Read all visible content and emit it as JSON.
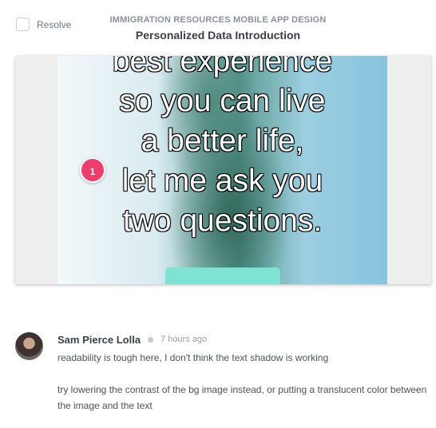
{
  "resolve": {
    "label": "Resolve"
  },
  "header": {
    "project": "IMMIGRATION RESOURCES MOBILE APP DESIGN",
    "screen_title": "Personalized Data Introduction"
  },
  "design": {
    "lines": [
      "best experience",
      "so you can live",
      "a better life,",
      "let me ask you",
      "two questions."
    ],
    "button_label": "",
    "accent_button_color": "#7ee3d2"
  },
  "pin": {
    "number": "1",
    "color": "#f03c6b"
  },
  "comment": {
    "author": "Sam Pierce Lolla",
    "time": "7 hours ago",
    "message_1": "readability is tough here, I don't think the text shadow is working",
    "message_2": "try lowering the contrast of the bg image instead, or putting a translucent color between the image and the text"
  }
}
